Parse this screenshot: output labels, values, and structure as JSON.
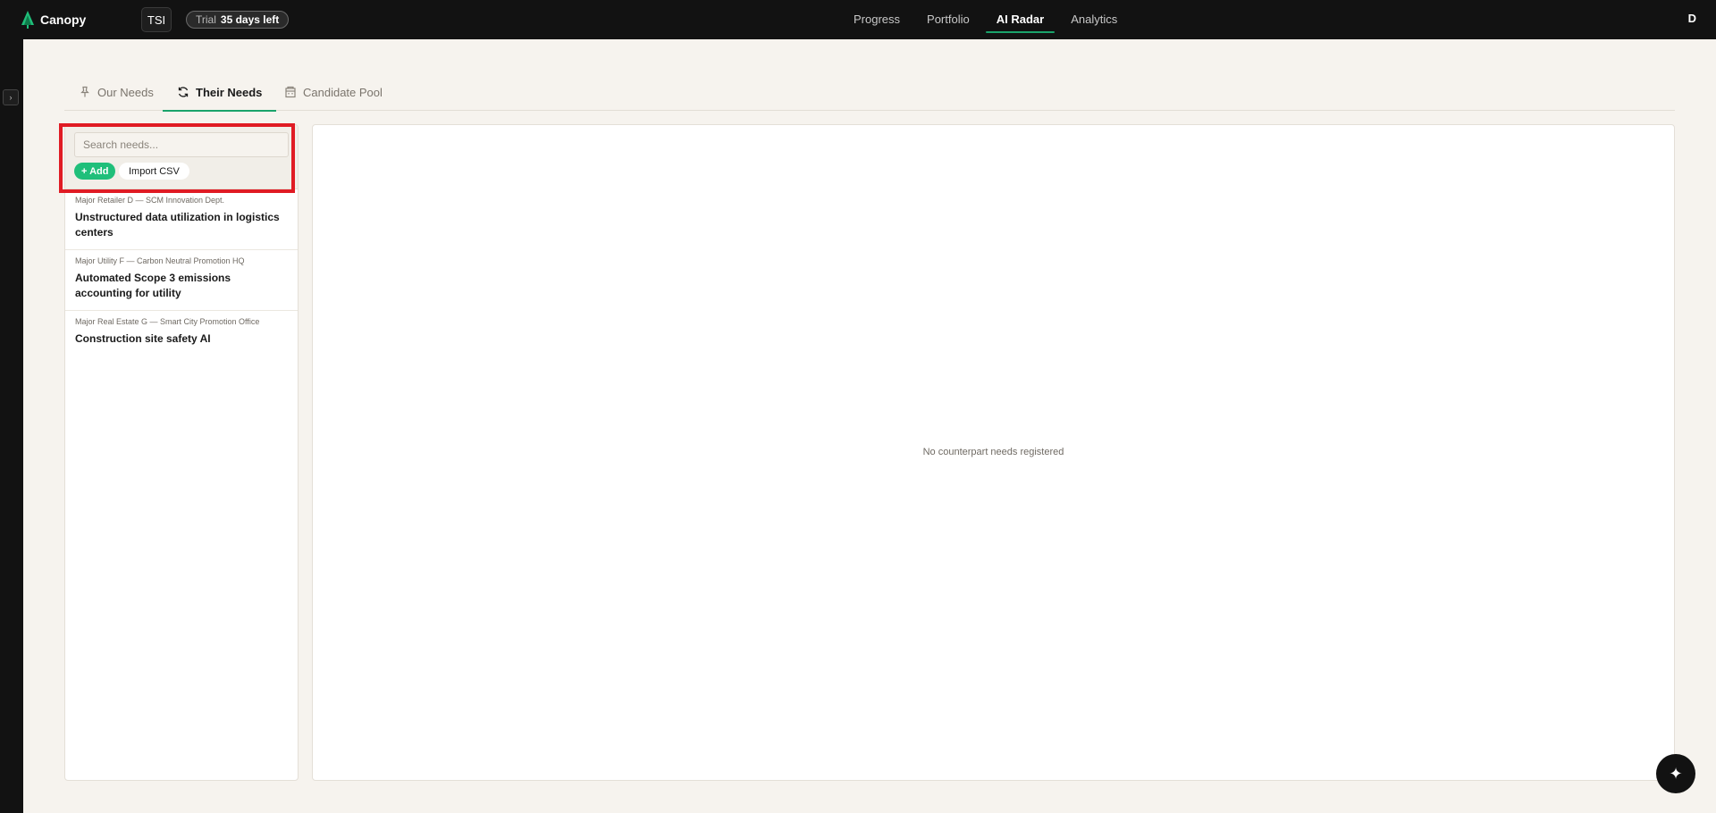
{
  "app": {
    "brand_name": "Canopy",
    "org_badge": "TSI",
    "trial_label": "Trial",
    "trial_days": "35 days left",
    "avatar_initial": "D",
    "accent_color": "#1aa36b"
  },
  "nav": {
    "items": [
      {
        "label": "Progress",
        "active": false
      },
      {
        "label": "Portfolio",
        "active": false
      },
      {
        "label": "AI Radar",
        "active": true
      },
      {
        "label": "Analytics",
        "active": false
      }
    ]
  },
  "rail": {
    "toggle_glyph": "›"
  },
  "tabs": [
    {
      "label": "Our Needs",
      "icon": "pin-icon",
      "active": false
    },
    {
      "label": "Their Needs",
      "icon": "refresh-icon",
      "active": true
    },
    {
      "label": "Candidate Pool",
      "icon": "building-icon",
      "active": false
    }
  ],
  "list": {
    "search_placeholder": "Search needs...",
    "search_value": "",
    "add_label": "+ Add",
    "import_label": "Import CSV",
    "items": [
      {
        "org": "Major Retailer D — SCM Innovation Dept.",
        "title": "Unstructured data utilization in logistics centers"
      },
      {
        "org": "Major Utility F — Carbon Neutral Promotion HQ",
        "title": "Automated Scope 3 emissions accounting for utility"
      },
      {
        "org": "Major Real Estate G — Smart City Promotion Office",
        "title": "Construction site safety AI"
      }
    ]
  },
  "detail": {
    "empty_message": "No counterpart needs registered"
  },
  "fab": {
    "icon": "sparkle-icon",
    "glyph": "✦"
  }
}
